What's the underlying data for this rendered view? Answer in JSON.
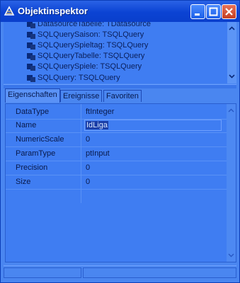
{
  "window": {
    "title": "Objektinspektor"
  },
  "tree": {
    "items": [
      {
        "label": "DatasourceTabelle: TDatasource"
      },
      {
        "label": "SQLQuerySaison: TSQLQuery"
      },
      {
        "label": "SQLQuerySpieltag: TSQLQuery"
      },
      {
        "label": "SQLQueryTabelle: TSQLQuery"
      },
      {
        "label": "SQLQuerySpiele: TSQLQuery"
      },
      {
        "label": "SQLQuery: TSQLQuery"
      }
    ]
  },
  "tabs": [
    {
      "label": "Eigenschaften"
    },
    {
      "label": "Ereignisse"
    },
    {
      "label": "Favoriten"
    }
  ],
  "properties": [
    {
      "name": "DataType",
      "value": "ftInteger"
    },
    {
      "name": "Name",
      "value": "IdLiga"
    },
    {
      "name": "NumericScale",
      "value": "0"
    },
    {
      "name": "ParamType",
      "value": "ptInput"
    },
    {
      "name": "Precision",
      "value": "0"
    },
    {
      "name": "Size",
      "value": "0"
    }
  ]
}
